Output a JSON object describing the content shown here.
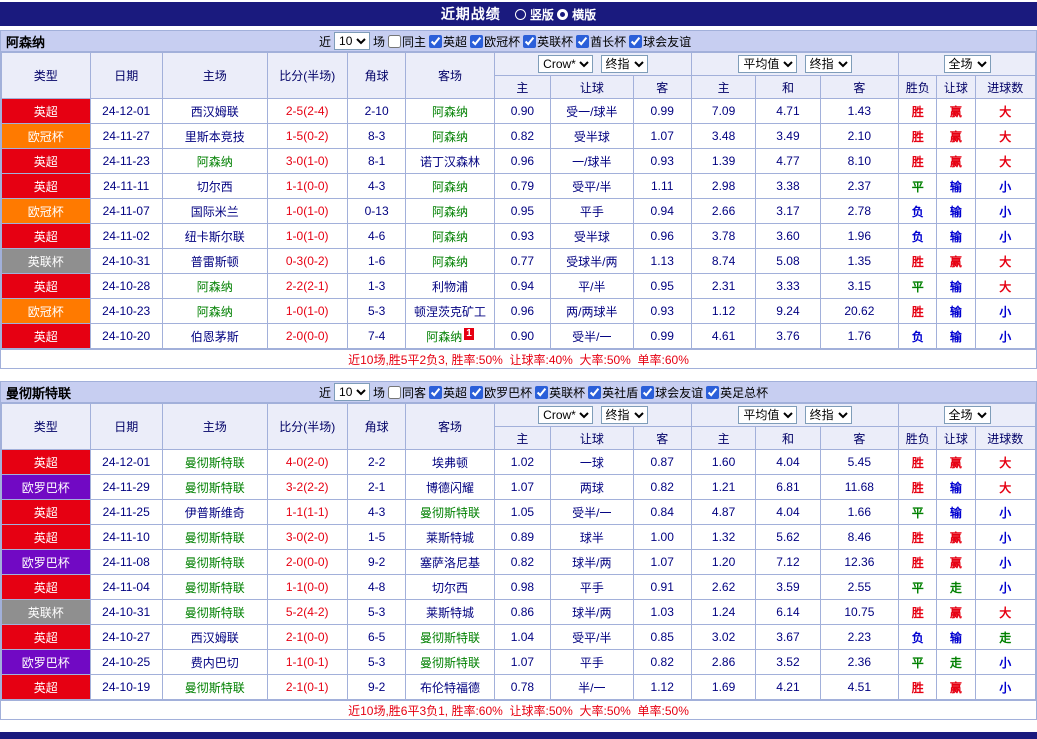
{
  "page": {
    "title": "近期战绩",
    "views": [
      {
        "label": "竖版",
        "selected": false
      },
      {
        "label": "横版",
        "selected": true
      }
    ]
  },
  "header": {
    "near_label": "近",
    "rounds_unit": "场",
    "type": "类型",
    "date": "日期",
    "home": "主场",
    "score": "比分(半场)",
    "corner": "角球",
    "away": "客场",
    "odds1_selects": [
      "Crow*",
      "终指"
    ],
    "odds1_cols": [
      "主",
      "让球",
      "客"
    ],
    "odds2_selects": [
      "平均值",
      "终指"
    ],
    "odds2_cols": [
      "主",
      "和",
      "客"
    ],
    "result_select": "全场",
    "result_cols": [
      "胜负",
      "让球",
      "进球数"
    ]
  },
  "colors": {
    "league": {
      "英超": "#e60012",
      "欧冠杯": "#ff7a00",
      "英联杯": "#8f8f8f",
      "欧罗巴杯": "#7109c4"
    },
    "result": {
      "胜": "#e60012",
      "平": "#008000",
      "负": "#0000d0",
      "赢": "#e60012",
      "输": "#0000d0",
      "走": "#008000",
      "大": "#e60012",
      "小": "#0000d0"
    }
  },
  "sections": [
    {
      "team": "阿森纳",
      "rounds": "10",
      "same_label": "同主",
      "same_checked": false,
      "leagues": [
        {
          "label": "英超",
          "checked": true
        },
        {
          "label": "欧冠杯",
          "checked": true
        },
        {
          "label": "英联杯",
          "checked": true
        },
        {
          "label": "酋长杯",
          "checked": true
        },
        {
          "label": "球会友谊",
          "checked": true
        }
      ],
      "rows": [
        {
          "league": "英超",
          "date": "24-12-01",
          "home": "西汉姆联",
          "home_focus": false,
          "score": "2-5(2-4)",
          "corner": "2-10",
          "away": "阿森纳",
          "away_focus": true,
          "odds1": [
            "0.90",
            "受一/球半",
            "0.99"
          ],
          "odds2": [
            "7.09",
            "4.71",
            "1.43"
          ],
          "results": [
            "胜",
            "赢",
            "大"
          ]
        },
        {
          "league": "欧冠杯",
          "date": "24-11-27",
          "home": "里斯本竞技",
          "home_focus": false,
          "score": "1-5(0-2)",
          "corner": "8-3",
          "away": "阿森纳",
          "away_focus": true,
          "odds1": [
            "0.82",
            "受半球",
            "1.07"
          ],
          "odds2": [
            "3.48",
            "3.49",
            "2.10"
          ],
          "results": [
            "胜",
            "赢",
            "大"
          ]
        },
        {
          "league": "英超",
          "date": "24-11-23",
          "home": "阿森纳",
          "home_focus": true,
          "score": "3-0(1-0)",
          "corner": "8-1",
          "away": "诺丁汉森林",
          "away_focus": false,
          "odds1": [
            "0.96",
            "一/球半",
            "0.93"
          ],
          "odds2": [
            "1.39",
            "4.77",
            "8.10"
          ],
          "results": [
            "胜",
            "赢",
            "大"
          ]
        },
        {
          "league": "英超",
          "date": "24-11-11",
          "home": "切尔西",
          "home_focus": false,
          "score": "1-1(0-0)",
          "corner": "4-3",
          "away": "阿森纳",
          "away_focus": true,
          "odds1": [
            "0.79",
            "受平/半",
            "1.11"
          ],
          "odds2": [
            "2.98",
            "3.38",
            "2.37"
          ],
          "results": [
            "平",
            "输",
            "小"
          ]
        },
        {
          "league": "欧冠杯",
          "date": "24-11-07",
          "home": "国际米兰",
          "home_focus": false,
          "score": "1-0(1-0)",
          "corner": "0-13",
          "away": "阿森纳",
          "away_focus": true,
          "odds1": [
            "0.95",
            "平手",
            "0.94"
          ],
          "odds2": [
            "2.66",
            "3.17",
            "2.78"
          ],
          "results": [
            "负",
            "输",
            "小"
          ]
        },
        {
          "league": "英超",
          "date": "24-11-02",
          "home": "纽卡斯尔联",
          "home_focus": false,
          "score": "1-0(1-0)",
          "corner": "4-6",
          "away": "阿森纳",
          "away_focus": true,
          "odds1": [
            "0.93",
            "受半球",
            "0.96"
          ],
          "odds2": [
            "3.78",
            "3.60",
            "1.96"
          ],
          "results": [
            "负",
            "输",
            "小"
          ]
        },
        {
          "league": "英联杯",
          "date": "24-10-31",
          "home": "普雷斯顿",
          "home_focus": false,
          "score": "0-3(0-2)",
          "corner": "1-6",
          "away": "阿森纳",
          "away_focus": true,
          "odds1": [
            "0.77",
            "受球半/两",
            "1.13"
          ],
          "odds2": [
            "8.74",
            "5.08",
            "1.35"
          ],
          "results": [
            "胜",
            "赢",
            "大"
          ]
        },
        {
          "league": "英超",
          "date": "24-10-28",
          "home": "阿森纳",
          "home_focus": true,
          "score": "2-2(2-1)",
          "corner": "1-3",
          "away": "利物浦",
          "away_focus": false,
          "odds1": [
            "0.94",
            "平/半",
            "0.95"
          ],
          "odds2": [
            "2.31",
            "3.33",
            "3.15"
          ],
          "results": [
            "平",
            "输",
            "大"
          ]
        },
        {
          "league": "欧冠杯",
          "date": "24-10-23",
          "home": "阿森纳",
          "home_focus": true,
          "score": "1-0(1-0)",
          "corner": "5-3",
          "away": "顿涅茨克矿工",
          "away_focus": false,
          "odds1": [
            "0.96",
            "两/两球半",
            "0.93"
          ],
          "odds2": [
            "1.12",
            "9.24",
            "20.62"
          ],
          "results": [
            "胜",
            "输",
            "小"
          ]
        },
        {
          "league": "英超",
          "date": "24-10-20",
          "home": "伯恩茅斯",
          "home_focus": false,
          "score": "2-0(0-0)",
          "corner": "7-4",
          "away": "阿森纳",
          "away_focus": true,
          "away_card": "1",
          "odds1": [
            "0.90",
            "受半/一",
            "0.99"
          ],
          "odds2": [
            "4.61",
            "3.76",
            "1.76"
          ],
          "results": [
            "负",
            "输",
            "小"
          ]
        }
      ],
      "summary": "近10场,胜5平2负3, 胜率:50%  让球率:40%  大率:50%  单率:60%"
    },
    {
      "team": "曼彻斯特联",
      "rounds": "10",
      "same_label": "同客",
      "same_checked": false,
      "leagues": [
        {
          "label": "英超",
          "checked": true
        },
        {
          "label": "欧罗巴杯",
          "checked": true
        },
        {
          "label": "英联杯",
          "checked": true
        },
        {
          "label": "英社盾",
          "checked": true
        },
        {
          "label": "球会友谊",
          "checked": true
        },
        {
          "label": "英足总杯",
          "checked": true
        }
      ],
      "rows": [
        {
          "league": "英超",
          "date": "24-12-01",
          "home": "曼彻斯特联",
          "home_focus": true,
          "score": "4-0(2-0)",
          "corner": "2-2",
          "away": "埃弗顿",
          "away_focus": false,
          "odds1": [
            "1.02",
            "一球",
            "0.87"
          ],
          "odds2": [
            "1.60",
            "4.04",
            "5.45"
          ],
          "results": [
            "胜",
            "赢",
            "大"
          ]
        },
        {
          "league": "欧罗巴杯",
          "date": "24-11-29",
          "home": "曼彻斯特联",
          "home_focus": true,
          "score": "3-2(2-2)",
          "corner": "2-1",
          "away": "博德闪耀",
          "away_focus": false,
          "odds1": [
            "1.07",
            "两球",
            "0.82"
          ],
          "odds2": [
            "1.21",
            "6.81",
            "11.68"
          ],
          "results": [
            "胜",
            "输",
            "大"
          ]
        },
        {
          "league": "英超",
          "date": "24-11-25",
          "home": "伊普斯维奇",
          "home_focus": false,
          "score": "1-1(1-1)",
          "corner": "4-3",
          "away": "曼彻斯特联",
          "away_focus": true,
          "odds1": [
            "1.05",
            "受半/一",
            "0.84"
          ],
          "odds2": [
            "4.87",
            "4.04",
            "1.66"
          ],
          "results": [
            "平",
            "输",
            "小"
          ]
        },
        {
          "league": "英超",
          "date": "24-11-10",
          "home": "曼彻斯特联",
          "home_focus": true,
          "score": "3-0(2-0)",
          "corner": "1-5",
          "away": "莱斯特城",
          "away_focus": false,
          "odds1": [
            "0.89",
            "球半",
            "1.00"
          ],
          "odds2": [
            "1.32",
            "5.62",
            "8.46"
          ],
          "results": [
            "胜",
            "赢",
            "小"
          ]
        },
        {
          "league": "欧罗巴杯",
          "date": "24-11-08",
          "home": "曼彻斯特联",
          "home_focus": true,
          "score": "2-0(0-0)",
          "corner": "9-2",
          "away": "塞萨洛尼基",
          "away_focus": false,
          "odds1": [
            "0.82",
            "球半/两",
            "1.07"
          ],
          "odds2": [
            "1.20",
            "7.12",
            "12.36"
          ],
          "results": [
            "胜",
            "赢",
            "小"
          ]
        },
        {
          "league": "英超",
          "date": "24-11-04",
          "home": "曼彻斯特联",
          "home_focus": true,
          "score": "1-1(0-0)",
          "corner": "4-8",
          "away": "切尔西",
          "away_focus": false,
          "odds1": [
            "0.98",
            "平手",
            "0.91"
          ],
          "odds2": [
            "2.62",
            "3.59",
            "2.55"
          ],
          "results": [
            "平",
            "走",
            "小"
          ]
        },
        {
          "league": "英联杯",
          "date": "24-10-31",
          "home": "曼彻斯特联",
          "home_focus": true,
          "score": "5-2(4-2)",
          "corner": "5-3",
          "away": "莱斯特城",
          "away_focus": false,
          "odds1": [
            "0.86",
            "球半/两",
            "1.03"
          ],
          "odds2": [
            "1.24",
            "6.14",
            "10.75"
          ],
          "results": [
            "胜",
            "赢",
            "大"
          ]
        },
        {
          "league": "英超",
          "date": "24-10-27",
          "home": "西汉姆联",
          "home_focus": false,
          "score": "2-1(0-0)",
          "corner": "6-5",
          "away": "曼彻斯特联",
          "away_focus": true,
          "odds1": [
            "1.04",
            "受平/半",
            "0.85"
          ],
          "odds2": [
            "3.02",
            "3.67",
            "2.23"
          ],
          "results": [
            "负",
            "输",
            "走"
          ]
        },
        {
          "league": "欧罗巴杯",
          "date": "24-10-25",
          "home": "费内巴切",
          "home_focus": false,
          "score": "1-1(0-1)",
          "corner": "5-3",
          "away": "曼彻斯特联",
          "away_focus": true,
          "odds1": [
            "1.07",
            "平手",
            "0.82"
          ],
          "odds2": [
            "2.86",
            "3.52",
            "2.36"
          ],
          "results": [
            "平",
            "走",
            "小"
          ]
        },
        {
          "league": "英超",
          "date": "24-10-19",
          "home": "曼彻斯特联",
          "home_focus": true,
          "score": "2-1(0-1)",
          "corner": "9-2",
          "away": "布伦特福德",
          "away_focus": false,
          "odds1": [
            "0.78",
            "半/一",
            "1.12"
          ],
          "odds2": [
            "1.69",
            "4.21",
            "4.51"
          ],
          "results": [
            "胜",
            "赢",
            "小"
          ]
        }
      ],
      "summary": "近10场,胜6平3负1, 胜率:60%  让球率:50%  大率:50%  单率:50%"
    }
  ]
}
